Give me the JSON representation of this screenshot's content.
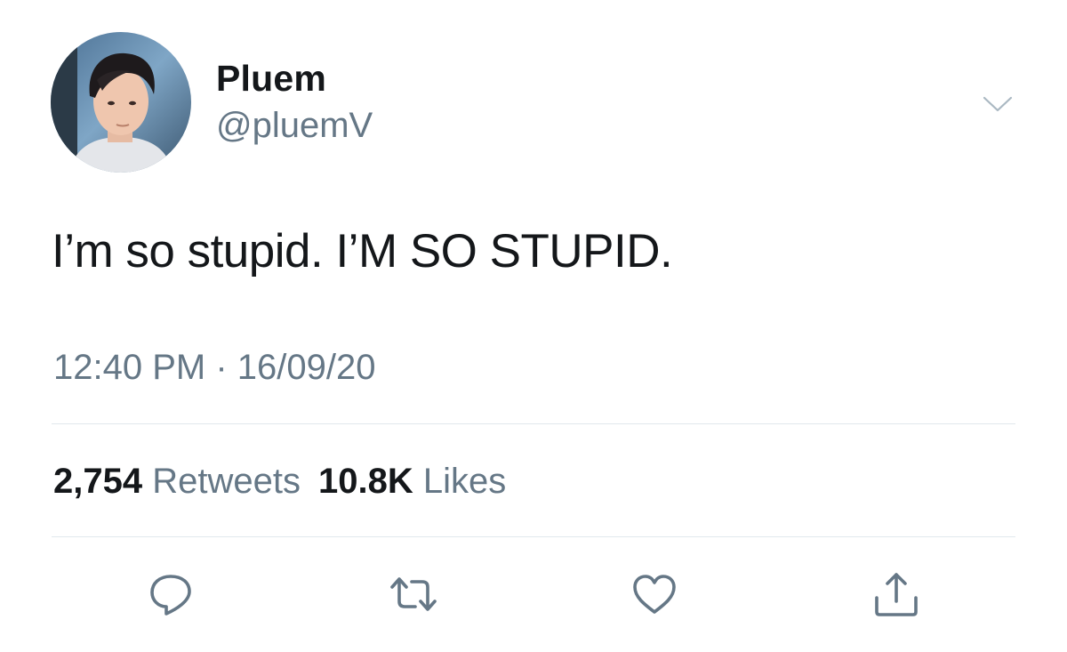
{
  "user": {
    "display_name": "Pluem",
    "handle": "@pluemV"
  },
  "tweet": {
    "text": "I’m so stupid. I’M SO STUPID.",
    "time": "12:40 PM",
    "separator": "·",
    "date": "16/09/20"
  },
  "stats": {
    "retweets_count": "2,754",
    "retweets_label": "Retweets",
    "likes_count": "10.8K",
    "likes_label": "Likes"
  },
  "icons": {
    "more": "chevron-down-icon",
    "reply": "reply-icon",
    "retweet": "retweet-icon",
    "like": "heart-icon",
    "share": "share-icon"
  },
  "colors": {
    "text": "#14171a",
    "secondary": "#657786",
    "divider": "#e1e8ed"
  }
}
